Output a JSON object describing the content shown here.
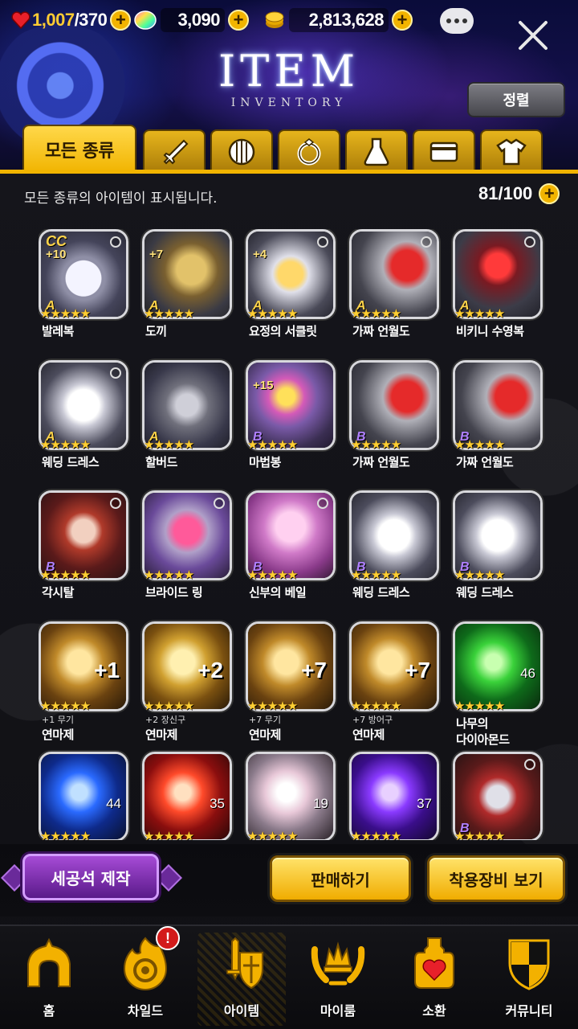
{
  "header": {
    "hp_value": "1,007",
    "hp_max": "/370",
    "gems": "3,090",
    "gold": "2,813,628",
    "title": "ITEM",
    "subtitle": "INVENTORY",
    "sort_label": "정렬"
  },
  "tabs": [
    {
      "label": "모든 종류",
      "icon": "all-types",
      "active": true
    },
    {
      "label": "",
      "icon": "sword-icon"
    },
    {
      "label": "",
      "icon": "shield-icon"
    },
    {
      "label": "",
      "icon": "ring-icon"
    },
    {
      "label": "",
      "icon": "flask-icon"
    },
    {
      "label": "",
      "icon": "card-icon"
    },
    {
      "label": "",
      "icon": "shirt-icon"
    }
  ],
  "info_text": "모든 종류의 아이템이 표시됩니다.",
  "inventory_count": "81/100",
  "items": [
    {
      "name": "발레복",
      "grade": "A",
      "enh": "+10",
      "badge": "CC",
      "stars": 5,
      "art": "dress-white",
      "corner": true
    },
    {
      "name": "도끼",
      "grade": "A",
      "enh": "+7",
      "stars": 5,
      "art": "axe",
      "corner": false
    },
    {
      "name": "요정의 서클릿",
      "grade": "A",
      "enh": "+4",
      "stars": 5,
      "art": "circlet",
      "corner": true
    },
    {
      "name": "가짜 언월도",
      "grade": "A",
      "stars": 5,
      "art": "glaive",
      "corner": true
    },
    {
      "name": "비키니 수영복",
      "grade": "A",
      "stars": 5,
      "art": "bikini",
      "corner": true
    },
    {
      "name": "웨딩 드레스",
      "grade": "A",
      "stars": 5,
      "art": "wedding",
      "corner": true
    },
    {
      "name": "할버드",
      "grade": "A",
      "stars": 5,
      "art": "halberd",
      "corner": false
    },
    {
      "name": "마법봉",
      "grade": "B",
      "enh": "+15",
      "stars": 5,
      "art": "wand",
      "corner": false
    },
    {
      "name": "가짜 언월도",
      "grade": "B",
      "stars": 5,
      "art": "glaive",
      "corner": false
    },
    {
      "name": "가짜 언월도",
      "grade": "B",
      "stars": 5,
      "art": "glaive",
      "corner": false
    },
    {
      "name": "각시탈",
      "grade": "B",
      "stars": 5,
      "art": "mask",
      "corner": true
    },
    {
      "name": "브라이드 링",
      "grade": "",
      "stars": 5,
      "art": "ring",
      "corner": true
    },
    {
      "name": "신부의 베일",
      "grade": "B",
      "stars": 5,
      "art": "veil",
      "corner": true
    },
    {
      "name": "웨딩 드레스",
      "grade": "B",
      "stars": 5,
      "art": "wedding",
      "corner": false
    },
    {
      "name": "웨딩 드레스",
      "grade": "B",
      "stars": 5,
      "art": "wedding",
      "corner": false
    },
    {
      "name": "연마제",
      "sub": "+1 무기",
      "enh_big": "+1",
      "stars": 5,
      "art": "orb-sword"
    },
    {
      "name": "연마제",
      "sub": "+2 장신구",
      "enh_big": "+2",
      "stars": 5,
      "art": "orb-ring"
    },
    {
      "name": "연마제",
      "sub": "+7 무기",
      "enh_big": "+7",
      "stars": 5,
      "art": "orb-sword"
    },
    {
      "name": "연마제",
      "sub": "+7 방어구",
      "enh_big": "+7",
      "stars": 5,
      "art": "orb-shield"
    },
    {
      "name": "나무의",
      "name2": "다이아몬드",
      "qty": "46",
      "stars": 5,
      "art": "gem-green"
    },
    {
      "name": "",
      "qty": "44",
      "stars": 5,
      "art": "gem-blue"
    },
    {
      "name": "",
      "qty": "35",
      "stars": 5,
      "art": "gem-red"
    },
    {
      "name": "",
      "qty": "19",
      "stars": 5,
      "art": "gem-white"
    },
    {
      "name": "",
      "qty": "37",
      "stars": 5,
      "art": "gem-purple"
    },
    {
      "name": "",
      "grade": "B",
      "stars": 5,
      "art": "coat",
      "corner": true
    }
  ],
  "actions": {
    "craft": "세공석 제작",
    "sell": "판매하기",
    "equipped": "착용장비 보기"
  },
  "nav": [
    {
      "label": "홈",
      "icon": "home-icon"
    },
    {
      "label": "차일드",
      "icon": "child-icon",
      "badge": "!"
    },
    {
      "label": "아이템",
      "icon": "item-icon",
      "active": true
    },
    {
      "label": "마이룸",
      "icon": "myroom-icon"
    },
    {
      "label": "소환",
      "icon": "summon-icon"
    },
    {
      "label": "커뮤니티",
      "icon": "community-icon"
    }
  ],
  "colors": {
    "accent": "#f1b400",
    "grade_a": "#ffd44a",
    "grade_b": "#b080ff",
    "craft": "#7a2cb0"
  }
}
